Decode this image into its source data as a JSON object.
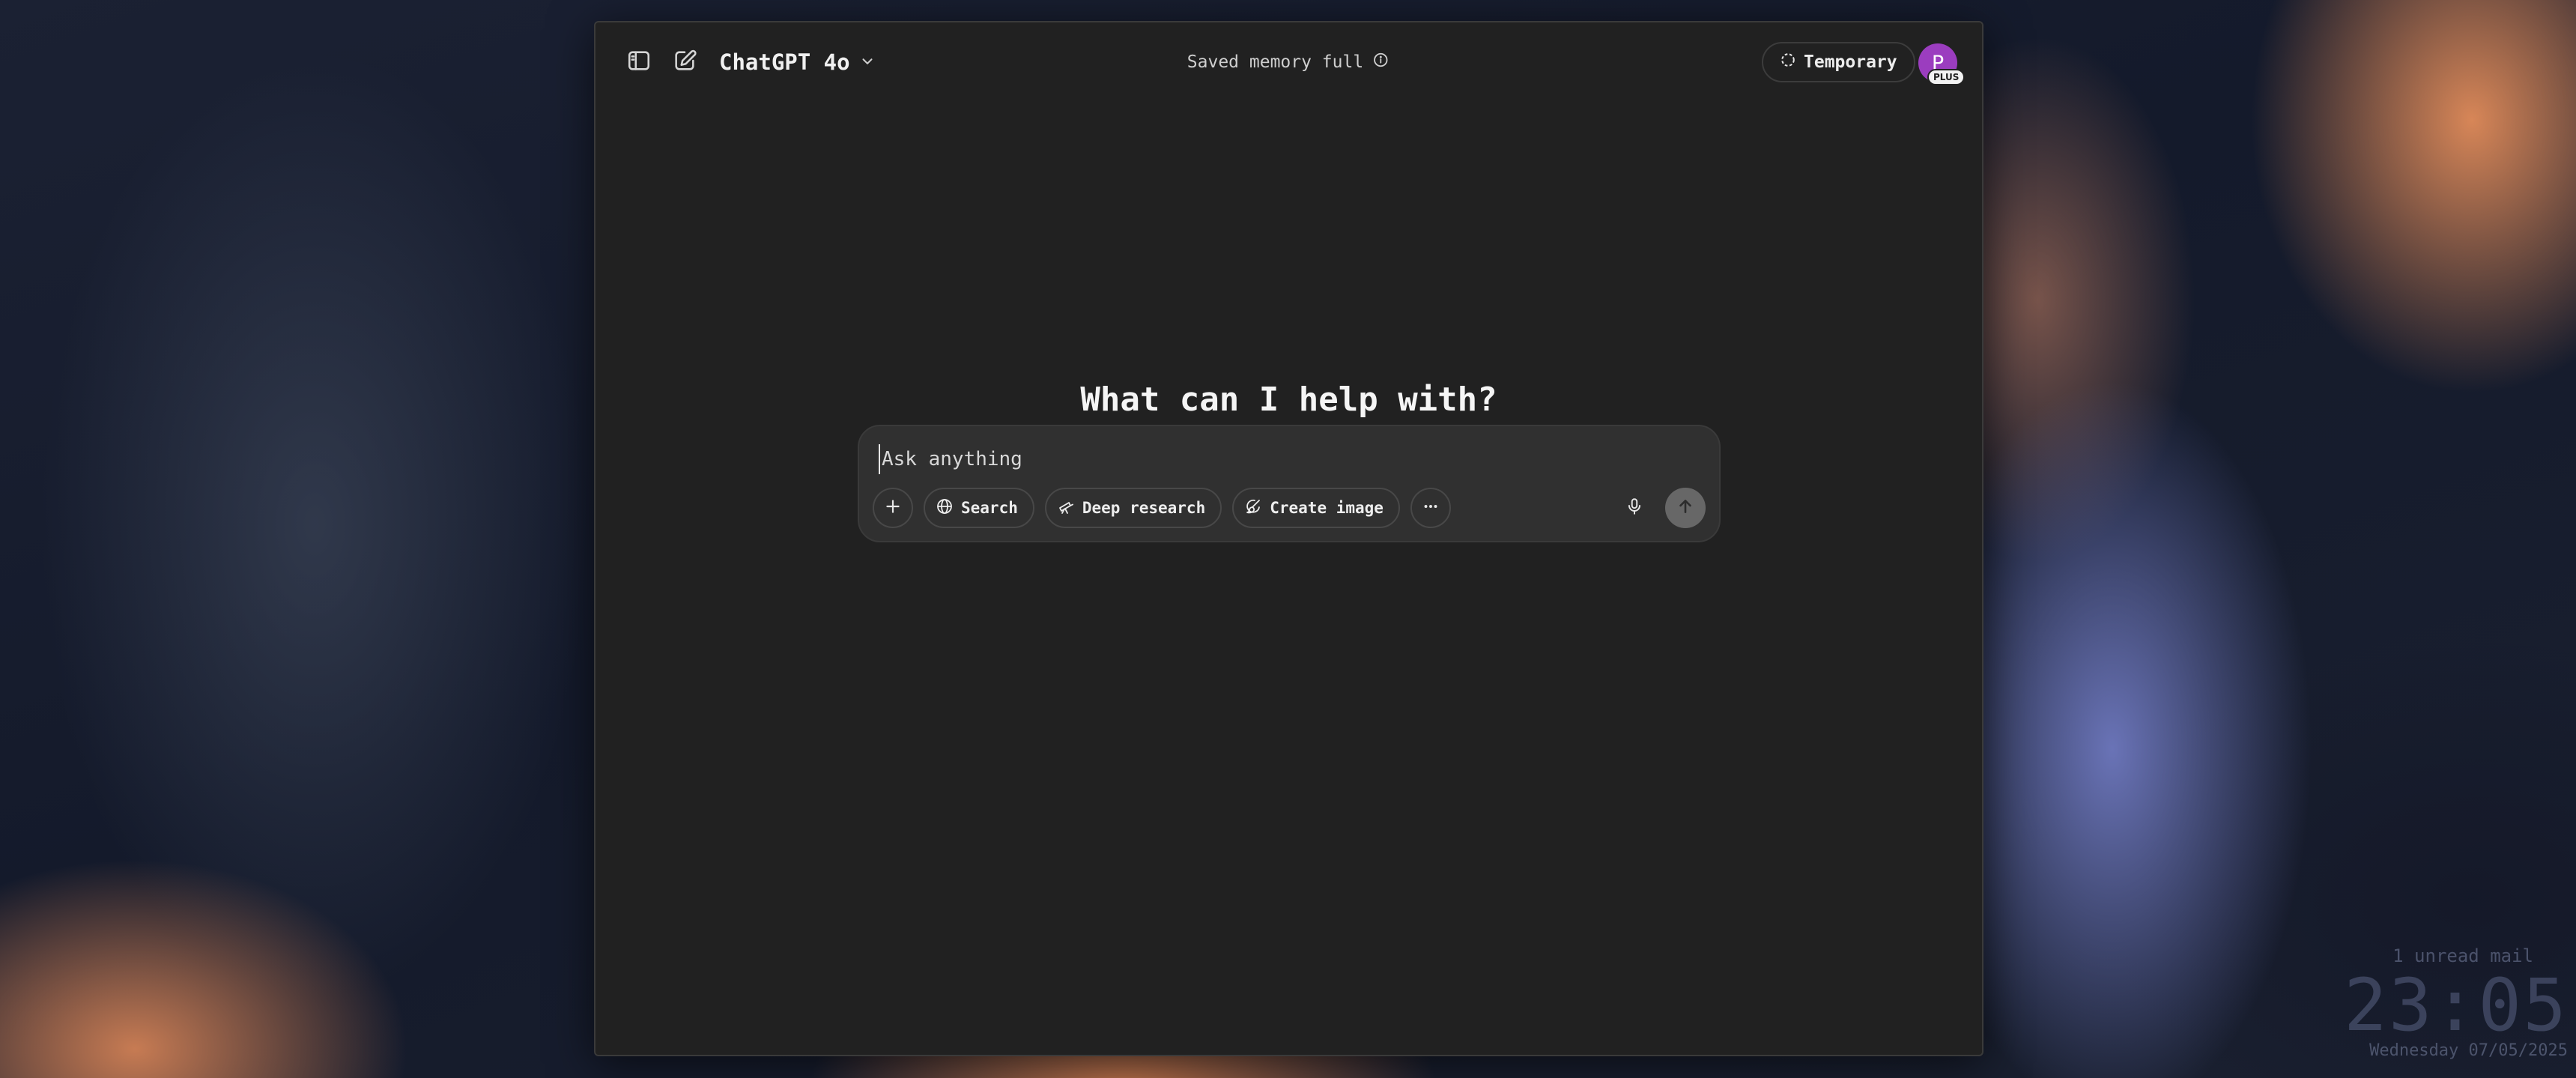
{
  "app": {
    "model_name": "ChatGPT 4o",
    "memory_status": "Saved memory full",
    "temporary_label": "Temporary",
    "avatar_initial": "P",
    "plan_badge": "PLUS"
  },
  "main": {
    "heading": "What can I help with?",
    "composer": {
      "placeholder": "Ask anything",
      "tools": [
        {
          "label": "Search",
          "icon": "globe-icon"
        },
        {
          "label": "Deep research",
          "icon": "telescope-icon"
        },
        {
          "label": "Create image",
          "icon": "paintbrush-icon"
        }
      ]
    }
  },
  "desktop": {
    "mail_notice": "1 unread mail",
    "clock": "23:05",
    "date": "Wednesday 07/05/2025"
  },
  "colors": {
    "window_bg": "#212121",
    "composer_bg": "#303030",
    "avatar": "#9b3dbf",
    "send_button": "#676767"
  }
}
